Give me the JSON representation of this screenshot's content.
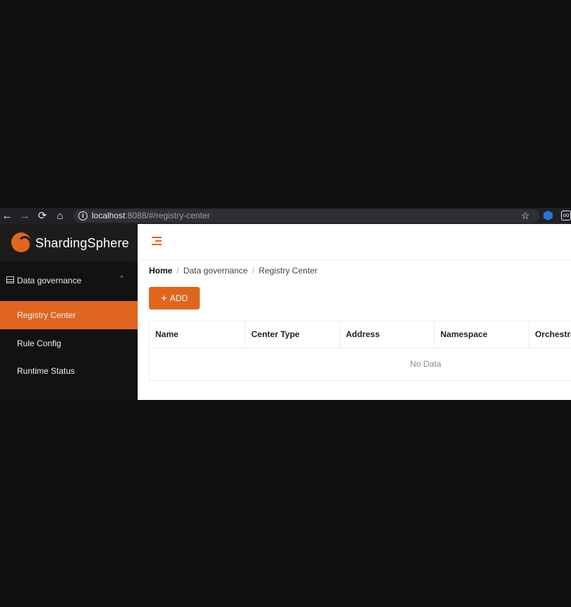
{
  "browser": {
    "back_glyph": "←",
    "forward_glyph": "→",
    "reload_glyph": "⟳",
    "home_glyph": "⌂",
    "url_host": "localhost",
    "url_rest": ":8088/#/registry-center",
    "star_glyph": "☆",
    "ext2_text": "oo"
  },
  "sidebar": {
    "logo_text": "ShardingSphere",
    "group_label": "Data governance",
    "chevron": "^",
    "items": [
      {
        "label": "Registry Center",
        "active": true
      },
      {
        "label": "Rule Config",
        "active": false
      },
      {
        "label": "Runtime Status",
        "active": false
      }
    ]
  },
  "main": {
    "breadcrumb": {
      "home": "Home",
      "separator": "/",
      "items": [
        "Data governance",
        "Registry Center"
      ]
    },
    "add_button": {
      "icon": "+",
      "label": "ADD"
    },
    "table": {
      "columns": [
        "Name",
        "Center Type",
        "Address",
        "Namespace",
        "Orchestra"
      ],
      "empty_text": "No Data"
    }
  },
  "colors": {
    "accent": "#e06620",
    "sidebar_bg": "#131210",
    "browser_bg": "#202124",
    "page_bg": "#111111"
  }
}
